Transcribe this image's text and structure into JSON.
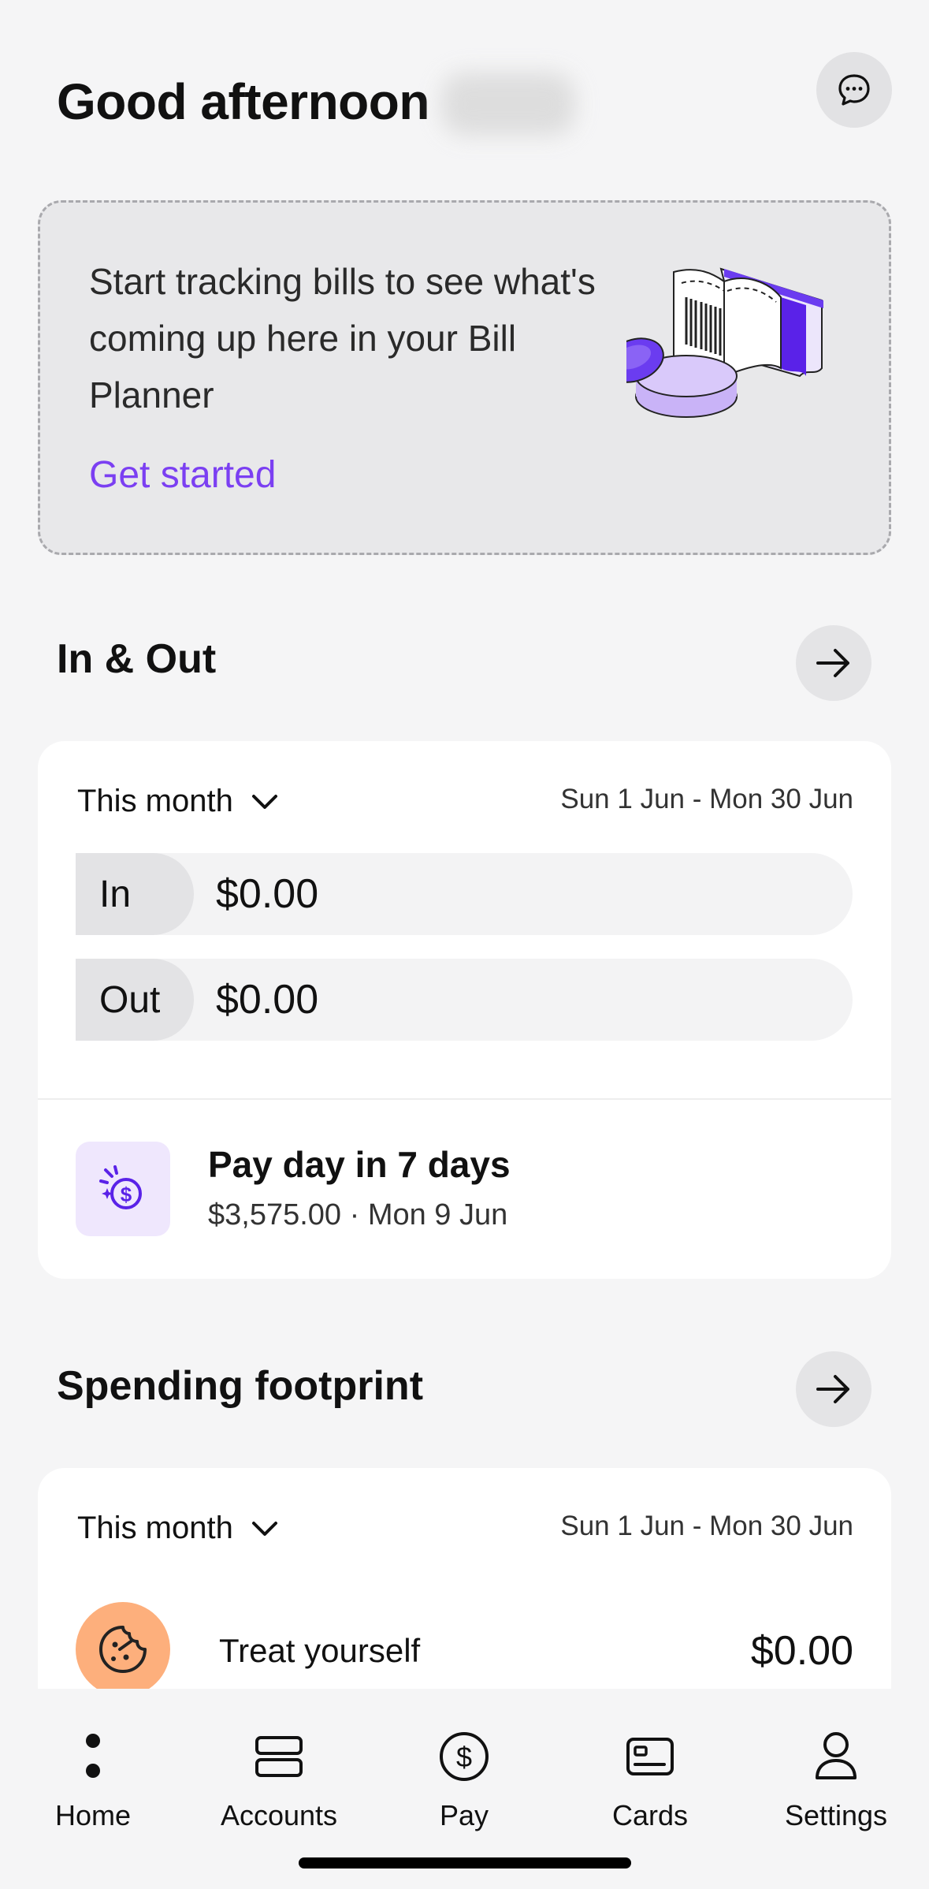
{
  "header": {
    "greeting": "Good afternoon"
  },
  "bill_planner": {
    "text": "Start tracking bills to see what's coming up here in your Bill Planner",
    "cta": "Get started"
  },
  "in_out": {
    "title": "In & Out",
    "period_label": "This month",
    "date_range": "Sun 1 Jun - Mon 30 Jun",
    "rows": [
      {
        "label": "In",
        "amount": "$0.00"
      },
      {
        "label": "Out",
        "amount": "$0.00"
      }
    ],
    "payday": {
      "title": "Pay day in 7 days",
      "subtitle": "$3,575.00 · Mon 9 Jun"
    }
  },
  "spending_footprint": {
    "title": "Spending footprint",
    "period_label": "This month",
    "date_range": "Sun 1 Jun - Mon 30 Jun",
    "categories": [
      {
        "label": "Treat yourself",
        "amount": "$0.00",
        "icon": "cookie-icon",
        "color": "#fdaf7c"
      }
    ]
  },
  "nav": {
    "items": [
      {
        "label": "Home",
        "icon": "home-dots-icon"
      },
      {
        "label": "Accounts",
        "icon": "accounts-icon"
      },
      {
        "label": "Pay",
        "icon": "dollar-circle-icon"
      },
      {
        "label": "Cards",
        "icon": "card-icon"
      },
      {
        "label": "Settings",
        "icon": "person-icon"
      }
    ]
  },
  "colors": {
    "accent": "#7b3ff2",
    "background": "#f5f5f6",
    "card": "#ffffff"
  }
}
